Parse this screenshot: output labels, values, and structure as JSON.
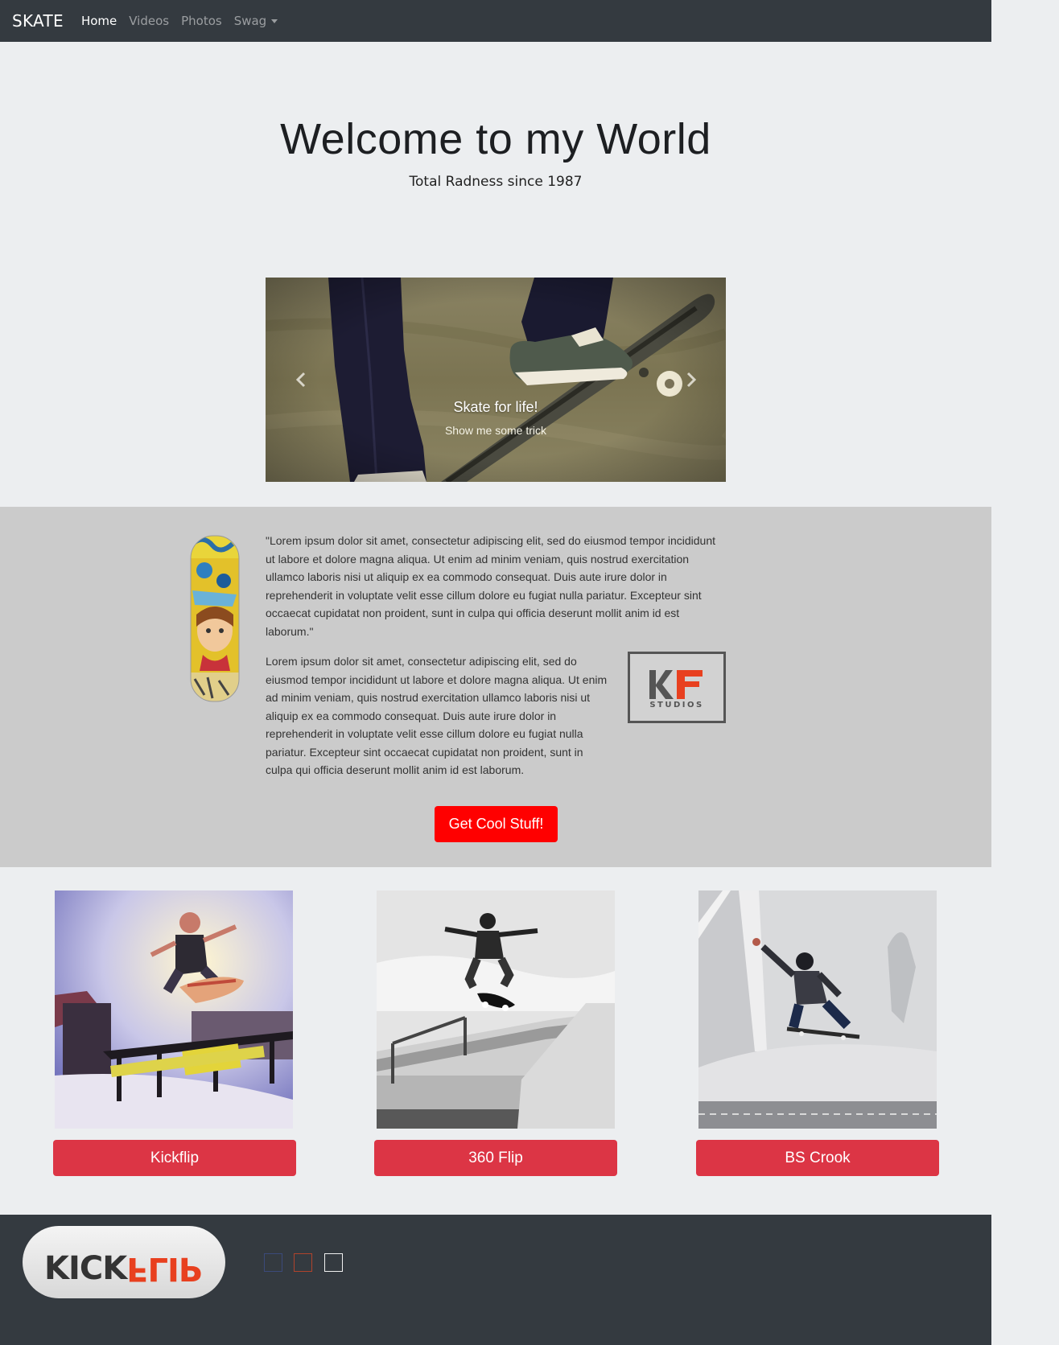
{
  "navbar": {
    "brand": "SKATE",
    "links": [
      {
        "label": "Home",
        "active": true
      },
      {
        "label": "Videos",
        "active": false
      },
      {
        "label": "Photos",
        "active": false
      },
      {
        "label": "Swag",
        "active": false,
        "dropdown": true
      }
    ]
  },
  "hero": {
    "title": "Welcome to my World",
    "subtitle": "Total Radness since 1987"
  },
  "carousel": {
    "caption_title": "Skate for life!",
    "caption_text": "Show me some trick",
    "prev_icon": "chevron-left-icon",
    "next_icon": "chevron-right-icon"
  },
  "about": {
    "quote": "\"Lorem ipsum dolor sit amet, consectetur adipiscing elit, sed do eiusmod tempor incididunt ut labore et dolore magna aliqua. Ut enim ad minim veniam, quis nostrud exercitation ullamco laboris nisi ut aliquip ex ea commodo consequat. Duis aute irure dolor in reprehenderit in voluptate velit esse cillum dolore eu fugiat nulla pariatur. Excepteur sint occaecat cupidatat non proident, sunt in culpa qui officia deserunt mollit anim id est laborum.\"",
    "body": "Lorem ipsum dolor sit amet, consectetur adipiscing elit, sed do eiusmod tempor incididunt ut labore et dolore magna aliqua. Ut enim ad minim veniam, quis nostrud exercitation ullamco laboris nisi ut aliquip ex ea commodo consequat. Duis aute irure dolor in reprehenderit in voluptate velit esse cillum dolore eu fugiat nulla pariatur. Excepteur sint occaecat cupidatat non proident, sunt in culpa qui officia deserunt mollit anim id est laborum.",
    "logo_letters": "KF",
    "logo_sub": "STUDIOS",
    "cta_label": "Get Cool Stuff!"
  },
  "tricks": [
    {
      "label": "Kickflip"
    },
    {
      "label": "360 Flip"
    },
    {
      "label": "BS Crook"
    }
  ],
  "footer": {
    "logo_text_a": "KICK",
    "logo_text_b": "FLIP"
  },
  "colors": {
    "navbar": "#343a40",
    "cta": "#ff0000",
    "trick_button": "#dc3545",
    "band": "#cbcbcb"
  }
}
